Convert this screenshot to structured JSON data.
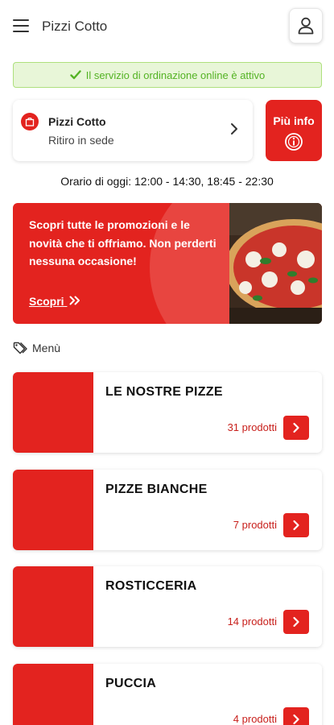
{
  "header": {
    "title": "Pizzi Cotto",
    "menu_icon": "hamburger-icon",
    "user_icon": "user-icon"
  },
  "online_banner": {
    "text": "Il servizio di ordinazione online è attivo",
    "icon": "check-icon"
  },
  "store": {
    "name": "Pizzi Cotto",
    "mode": "Ritiro in sede",
    "icon": "shopping-bag-icon"
  },
  "info_button": {
    "label": "Più info",
    "icon": "info-icon"
  },
  "hours_text": "Orario di oggi: 12:00 - 14:30, 18:45 - 22:30",
  "promo": {
    "text": "Scopri tutte le promozioni e le novità che ti offriamo. Non perderti nessuna occasione!",
    "link_label": "Scopri",
    "link_icon": "double-chevron-right-icon"
  },
  "menu": {
    "title": "Menù",
    "icon": "tags-icon",
    "categories": [
      {
        "name": "LE NOSTRE PIZZE",
        "count": "31 prodotti"
      },
      {
        "name": "PIZZE BIANCHE",
        "count": "7 prodotti"
      },
      {
        "name": "ROSTICCERIA",
        "count": "14 prodotti"
      },
      {
        "name": "PUCCIA",
        "count": "4 prodotti"
      }
    ]
  },
  "colors": {
    "accent": "#e3231f",
    "success_bg": "#e8f6d8",
    "success_text": "#54b324"
  }
}
